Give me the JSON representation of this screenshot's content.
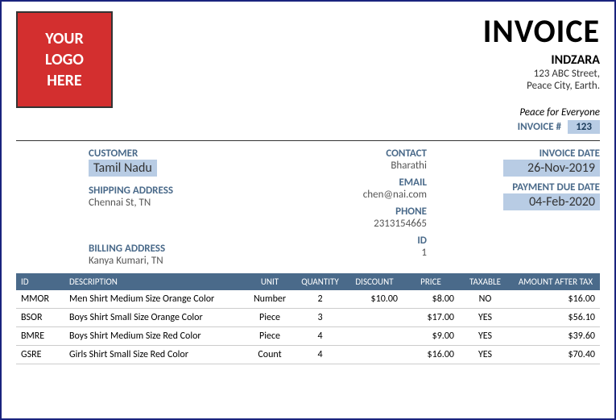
{
  "logo": {
    "l1": "YOUR",
    "l2": "LOGO",
    "l3": "HERE"
  },
  "header": {
    "title": "INVOICE",
    "company": "INDZARA",
    "addr1": "123 ABC Street,",
    "addr2": "Peace City, Earth.",
    "tagline": "Peace for Everyone",
    "invnum_label": "INVOICE #",
    "invnum": "123"
  },
  "customer": {
    "label": "CUSTOMER",
    "name": "Tamil Nadu",
    "shipping_label": "SHIPPING ADDRESS",
    "shipping": "Chennai St, TN",
    "billing_label": "BILLING ADDRESS",
    "billing": "Kanya Kumari, TN"
  },
  "contact": {
    "label": "CONTACT",
    "name": "Bharathi",
    "email_label": "EMAIL",
    "email": "chen@nai.com",
    "phone_label": "PHONE",
    "phone": "2313154665",
    "id_label": "ID",
    "id": "1"
  },
  "dates": {
    "inv_label": "INVOICE DATE",
    "inv_date": "26-Nov-2019",
    "due_label": "PAYMENT DUE DATE",
    "due_date": "04-Feb-2020"
  },
  "thead": {
    "id": "ID",
    "desc": "DESCRIPTION",
    "unit": "UNIT",
    "qty": "QUANTITY",
    "disc": "DISCOUNT",
    "price": "PRICE",
    "tax": "TAXABLE",
    "amt": "AMOUNT AFTER TAX"
  },
  "rows": [
    {
      "id": "MMOR",
      "desc": "Men Shirt Medium Size Orange Color",
      "unit": "Number",
      "qty": "2",
      "disc": "$10.00",
      "price": "$8.00",
      "tax": "NO",
      "amt": "$16.00"
    },
    {
      "id": "BSOR",
      "desc": "Boys Shirt Small Size Orange Color",
      "unit": "Piece",
      "qty": "3",
      "disc": "",
      "price": "$17.00",
      "tax": "YES",
      "amt": "$56.10"
    },
    {
      "id": "BMRE",
      "desc": "Boys Shirt Medium Size Red Color",
      "unit": "Piece",
      "qty": "4",
      "disc": "",
      "price": "$9.00",
      "tax": "YES",
      "amt": "$39.60"
    },
    {
      "id": "GSRE",
      "desc": "Girls Shirt Small Size Red Color",
      "unit": "Count",
      "qty": "4",
      "disc": "",
      "price": "$16.00",
      "tax": "YES",
      "amt": "$70.40"
    }
  ]
}
